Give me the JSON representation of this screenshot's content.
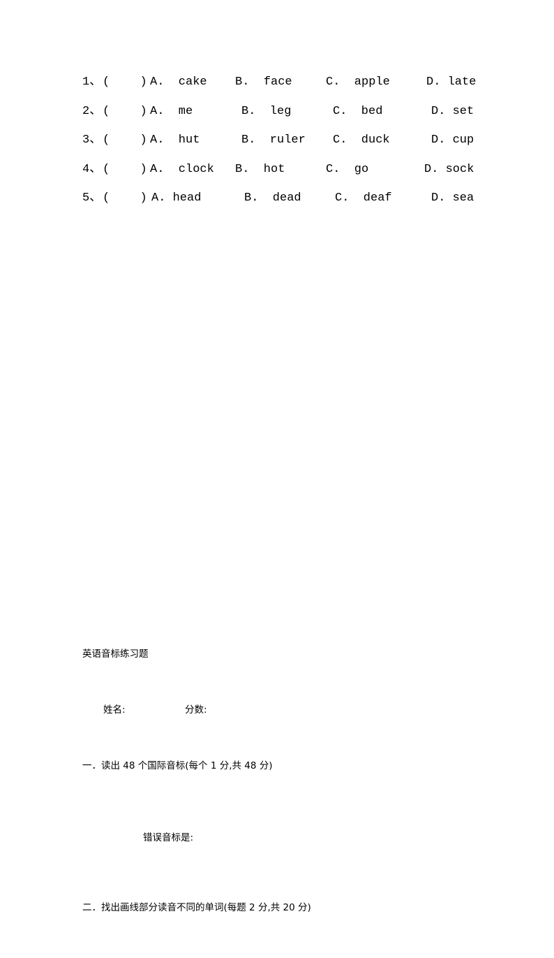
{
  "document": {
    "title": "英语音标练习题",
    "name_label": "姓名:",
    "score_label": "分数:",
    "section_one": "一．读出 48 个国际音标(每个 1 分,共 48 分)",
    "wrong_symbols_label": "错误音标是:",
    "section_two": "二．找出画线部分读音不同的单词(每题 2 分,共 20 分)"
  },
  "exercise": {
    "rows": [
      {
        "number": "1、",
        "blank": "(    )",
        "a": "A.  cake",
        "b": "B.  face",
        "c": "C.  apple",
        "d": "D. late"
      },
      {
        "number": "2、",
        "blank": "(    )",
        "a": "A.  me",
        "b": "B.  leg",
        "c": "C.  bed",
        "d": "D. set"
      },
      {
        "number": "3、",
        "blank": "(    )",
        "a": "A.  hut",
        "b": "B.  ruler",
        "c": "C.  duck",
        "d": "D. cup"
      },
      {
        "number": "4、",
        "blank": "(    )",
        "a": "A.  clock",
        "b": "B.  hot",
        "c": "C.  go",
        "d": "D. sock"
      },
      {
        "number": "5、",
        "blank": "(    )",
        "a": "A. head",
        "b": "B.  dead",
        "c": "C.  deaf",
        "d": "D. sea"
      }
    ]
  }
}
